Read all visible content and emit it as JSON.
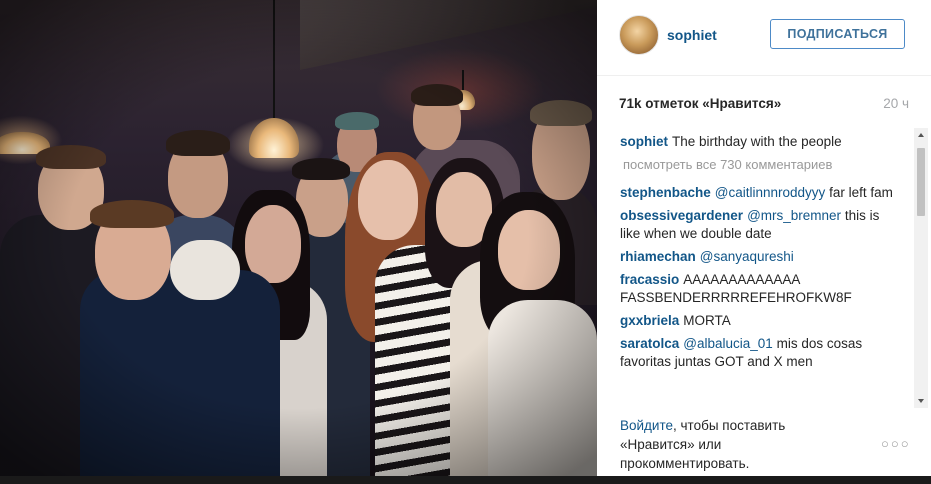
{
  "post": {
    "username": "sophiet",
    "follow_label": "ПОДПИСАТЬСЯ",
    "likes_text": "71k отметок «Нравится»",
    "timestamp": "20 ч",
    "caption": {
      "user": "sophiet",
      "text": "The birthday with the people"
    },
    "view_all": "посмотреть все 730 комментариев",
    "comments": [
      {
        "user": "stephenbache",
        "mention": "@caitlinnnroddyyy",
        "text": "far left fam"
      },
      {
        "user": "obsessivegardener",
        "mention": "@mrs_bremner",
        "text": "this is like when we double date"
      },
      {
        "user": "rhiamechan",
        "mention": "@sanyaqureshi",
        "text": ""
      },
      {
        "user": "fracassio",
        "mention": "",
        "text": "AAAAAAAAAAAAA FASSBENDERRRRREFEHROFKW8F"
      },
      {
        "user": "gxxbriela",
        "mention": "",
        "text": "MORTA"
      },
      {
        "user": "saratolca",
        "mention": "@albalucia_01",
        "text": "mis dos cosas favoritas juntas GOT and X men"
      }
    ],
    "login": {
      "link": "Войдите",
      "rest": ", чтобы поставить «Нравится» или прокомментировать."
    },
    "icons": {
      "more": "more-options-icon",
      "scroll_up": "scroll-up-arrow-icon",
      "scroll_down": "scroll-down-arrow-icon"
    }
  },
  "colors": {
    "link": "#125688",
    "follow_border": "#4d8ac7",
    "muted": "#a5a7aa"
  }
}
